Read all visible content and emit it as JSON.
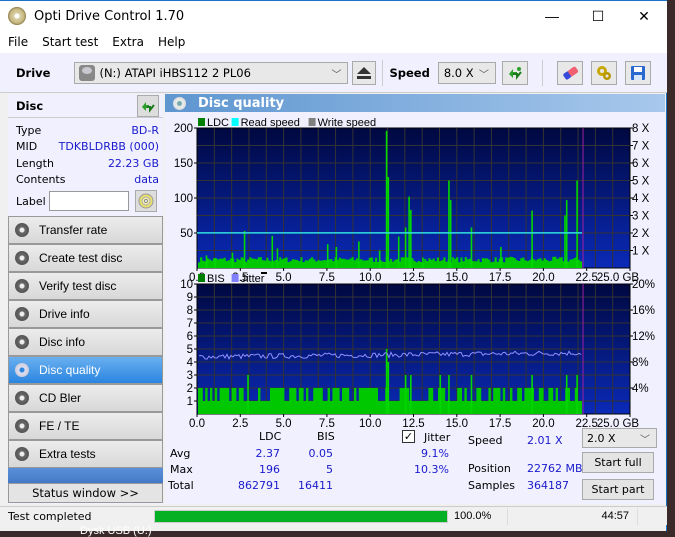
{
  "window": {
    "title": "Opti Drive Control 1.70",
    "controls": {
      "minimize": "—",
      "maximize": "☐",
      "close": "✕"
    }
  },
  "menu": [
    "File",
    "Start test",
    "Extra",
    "Help"
  ],
  "toolbar": {
    "drive_label": "Drive",
    "drive_value": "(N:)   ATAPI iHBS112   2 PL06",
    "speed_label": "Speed",
    "speed_value": "8.0 X",
    "icons": [
      "drive-icon",
      "eject-icon",
      "refresh-icon",
      "eraser-icon",
      "gears-icon",
      "save-icon"
    ]
  },
  "disc": {
    "header": "Disc",
    "fields": [
      {
        "key": "Type",
        "value": "BD-R"
      },
      {
        "key": "MID",
        "value": "TDKBLDRBB (000)"
      },
      {
        "key": "Length",
        "value": "22.23 GB"
      },
      {
        "key": "Contents",
        "value": "data"
      }
    ],
    "label_key": "Label",
    "label_value": ""
  },
  "nav": [
    {
      "label": "Transfer rate",
      "active": false
    },
    {
      "label": "Create test disc",
      "active": false
    },
    {
      "label": "Verify test disc",
      "active": false
    },
    {
      "label": "Drive info",
      "active": false
    },
    {
      "label": "Disc info",
      "active": false
    },
    {
      "label": "Disc quality",
      "active": true
    },
    {
      "label": "CD Bler",
      "active": false
    },
    {
      "label": "FE / TE",
      "active": false
    },
    {
      "label": "Extra tests",
      "active": false
    }
  ],
  "status_window_button": "Status window >>",
  "main": {
    "title": "Disc quality"
  },
  "stats": {
    "col_ldc": "LDC",
    "col_bis": "BIS",
    "jitter_label": "Jitter",
    "jitter_checked": true,
    "rows": [
      {
        "label": "Avg",
        "ldc": "2.37",
        "bis": "0.05",
        "jitter": "9.1%"
      },
      {
        "label": "Max",
        "ldc": "196",
        "bis": "5",
        "jitter": "10.3%"
      },
      {
        "label": "Total",
        "ldc": "862791",
        "bis": "16411",
        "jitter": ""
      }
    ],
    "speed_label": "Speed",
    "speed_value": "2.01 X",
    "position_label": "Position",
    "position_value": "22762 MB",
    "samples_label": "Samples",
    "samples_value": "364187",
    "speed_select": "2.0 X",
    "start_full": "Start full",
    "start_part": "Start part"
  },
  "statusbar": {
    "text": "Test completed",
    "progress": 1.0,
    "percent": "100.0%",
    "time": "44:57"
  },
  "desktop_text": "Dysk USB (U:)",
  "chart_data": [
    {
      "type": "bar",
      "title": "LDC / Read speed / Write speed",
      "legend": [
        {
          "name": "LDC",
          "color": "#008000"
        },
        {
          "name": "Read speed",
          "color": "#00ffff"
        },
        {
          "name": "Write speed",
          "color": "#808080"
        }
      ],
      "xlabel": "GB",
      "xlim": [
        0,
        25
      ],
      "x_ticks": [
        "0.0",
        "2.5",
        "5.0",
        "7.5",
        "10.0",
        "12.5",
        "15.0",
        "17.5",
        "20.0",
        "22.5",
        "25.0 GB"
      ],
      "ylim": [
        0,
        200
      ],
      "y_ticks": [
        "50",
        "100",
        "150",
        "200"
      ],
      "y2lim": [
        0,
        8
      ],
      "y2_ticks": [
        "1 X",
        "2 X",
        "3 X",
        "4 X",
        "5 X",
        "6 X",
        "7 X",
        "8 X"
      ],
      "data_end_gb": 22.23,
      "ldc_baseline": 8,
      "ldc_spikes": [
        {
          "x": 0.5,
          "y": 18
        },
        {
          "x": 1.0,
          "y": 14
        },
        {
          "x": 2.0,
          "y": 22
        },
        {
          "x": 2.7,
          "y": 53
        },
        {
          "x": 4.3,
          "y": 46
        },
        {
          "x": 4.6,
          "y": 28
        },
        {
          "x": 7.5,
          "y": 34
        },
        {
          "x": 8.0,
          "y": 30
        },
        {
          "x": 9.3,
          "y": 38
        },
        {
          "x": 10.5,
          "y": 25
        },
        {
          "x": 10.9,
          "y": 196
        },
        {
          "x": 11.0,
          "y": 130
        },
        {
          "x": 11.6,
          "y": 45
        },
        {
          "x": 12.0,
          "y": 58
        },
        {
          "x": 12.2,
          "y": 102
        },
        {
          "x": 12.3,
          "y": 83
        },
        {
          "x": 13.0,
          "y": 15
        },
        {
          "x": 14.5,
          "y": 125
        },
        {
          "x": 14.6,
          "y": 97
        },
        {
          "x": 15.8,
          "y": 58
        },
        {
          "x": 17.5,
          "y": 30
        },
        {
          "x": 19.3,
          "y": 82
        },
        {
          "x": 21.2,
          "y": 75
        },
        {
          "x": 21.3,
          "y": 97
        },
        {
          "x": 21.9,
          "y": 125
        }
      ],
      "read_speed_x": 2.01
    },
    {
      "type": "bar",
      "title": "BIS / Jitter",
      "legend": [
        {
          "name": "BIS",
          "color": "#008000"
        },
        {
          "name": "Jitter",
          "color": "#8080ff"
        }
      ],
      "xlabel": "GB",
      "xlim": [
        0,
        25
      ],
      "x_ticks": [
        "0.0",
        "2.5",
        "5.0",
        "7.5",
        "10.0",
        "12.5",
        "15.0",
        "17.5",
        "20.0",
        "22.5",
        "25.0 GB"
      ],
      "ylim": [
        0,
        10
      ],
      "y_ticks": [
        "1",
        "2",
        "3",
        "4",
        "5",
        "6",
        "7",
        "8",
        "9",
        "10"
      ],
      "y2lim": [
        0,
        20
      ],
      "y2_ticks": [
        "4%",
        "8%",
        "12%",
        "16%",
        "20%"
      ],
      "data_end_gb": 22.23,
      "bis_baseline": 1,
      "bis_spikes": [
        {
          "x": 2.9,
          "y": 3
        },
        {
          "x": 10.9,
          "y": 5
        },
        {
          "x": 11.0,
          "y": 4
        },
        {
          "x": 12.0,
          "y": 3
        },
        {
          "x": 12.3,
          "y": 3
        },
        {
          "x": 14.0,
          "y": 3
        },
        {
          "x": 14.5,
          "y": 3
        },
        {
          "x": 15.8,
          "y": 3
        },
        {
          "x": 19.3,
          "y": 3
        },
        {
          "x": 21.3,
          "y": 3
        },
        {
          "x": 21.9,
          "y": 3
        }
      ],
      "jitter_avg_pct": 9.1,
      "jitter_max_pct": 10.3
    }
  ]
}
